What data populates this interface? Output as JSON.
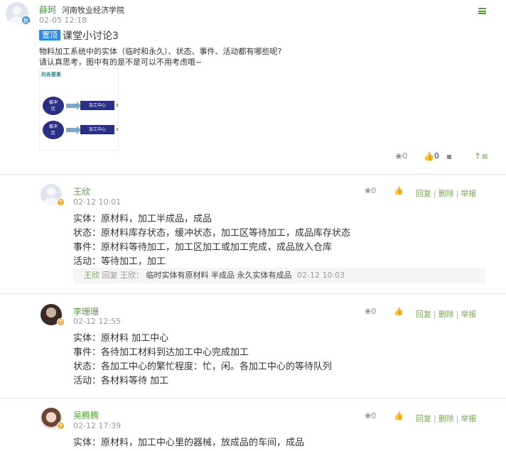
{
  "post": {
    "author": "薛珂",
    "author_badge": "教",
    "school": "河南牧业经济学院",
    "time": "02-05 12:18",
    "pin_tag": "置顶",
    "title": "课堂小讨论3",
    "body_line1": "物料加工系统中的实体（临时和永久）、状态、事件、活动都有哪些呢?",
    "body_line2": "请认真思考，图中有的是不是可以不用考虑哦~",
    "image": {
      "heading": "的各要素",
      "buffer_label_1": "缓冲",
      "buffer_label_2": "区",
      "process_label": "加工中心"
    },
    "stats": {
      "like_count": "0",
      "thumb_count": "0"
    }
  },
  "replies": [
    {
      "name": "王欣",
      "badge": "学",
      "time": "02-12 10:01",
      "lines": [
        "实体：原材料，加工半成品，成品",
        "状态：原材料库存状态，缓冲状态，加工区等待加工，成品库存状态",
        "事件：原材料等待加工，加工区加工或加工完成，成品放入仓库",
        "活动：等待加工，加工"
      ],
      "like_count": "0",
      "ops": {
        "reply": "回复",
        "delete": "删除",
        "report": "举报"
      },
      "subreply": {
        "name": "王欣",
        "mid": "回复 王欣：",
        "text": "临时实体有原材料 半成品 永久实体有成品",
        "time": "02-12 10:03"
      }
    },
    {
      "name": "李珊珊",
      "badge": "学",
      "time": "02-12 12:55",
      "lines": [
        "实体：原材料 加工中心",
        "事件：各待加工材料到达加工中心完成加工",
        "状态：各加工中心的繁忙程度：忙，闲。各加工中心的等待队列",
        "活动：各材料等待  加工"
      ],
      "like_count": "0",
      "ops": {
        "reply": "回复",
        "delete": "删除",
        "report": "举报"
      }
    },
    {
      "name": "吴腾腾",
      "badge": "学",
      "time": "02-12 17:39",
      "lines": [
        "实体：原材料，加工中心里的器械，放成品的车间，成品"
      ],
      "like_count": "0",
      "ops": {
        "reply": "回复",
        "delete": "删除",
        "report": "举报"
      }
    }
  ],
  "icons": {
    "menu": "menu-icon",
    "flower": "flower-icon",
    "thumb": "thumbs-up-icon",
    "comment": "comment-icon",
    "sort": "sort-icon"
  },
  "colors": {
    "accent_green": "#7aa65a",
    "pin_blue": "#2f8ae5",
    "student_badge": "#f0a020"
  }
}
